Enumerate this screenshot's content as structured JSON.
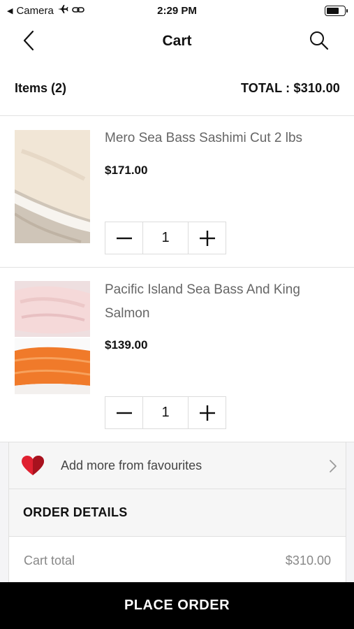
{
  "status_bar": {
    "back_app": "Camera",
    "time": "2:29 PM",
    "icons": [
      "back-arrow-icon",
      "airplane-icon",
      "link-icon",
      "battery-icon"
    ]
  },
  "nav": {
    "title": "Cart",
    "icons": [
      "back-chevron-icon",
      "search-icon"
    ]
  },
  "summary": {
    "items_label": "Items (2)",
    "total_label": "TOTAL : $310.00"
  },
  "cart_items": [
    {
      "name": "Mero Sea Bass Sashimi Cut 2 lbs",
      "price": "$171.00",
      "quantity": "1"
    },
    {
      "name": "Pacific Island Sea Bass And King Salmon",
      "price": "$139.00",
      "quantity": "1"
    }
  ],
  "favourites": {
    "label": "Add more from favourites",
    "icon": "heart-icon",
    "accent": "#e02030"
  },
  "order_details": {
    "heading": "ORDER DETAILS",
    "rows": [
      {
        "label": "Cart total",
        "value": "$310.00"
      }
    ]
  },
  "primary_action": {
    "label": "PLACE ORDER"
  }
}
